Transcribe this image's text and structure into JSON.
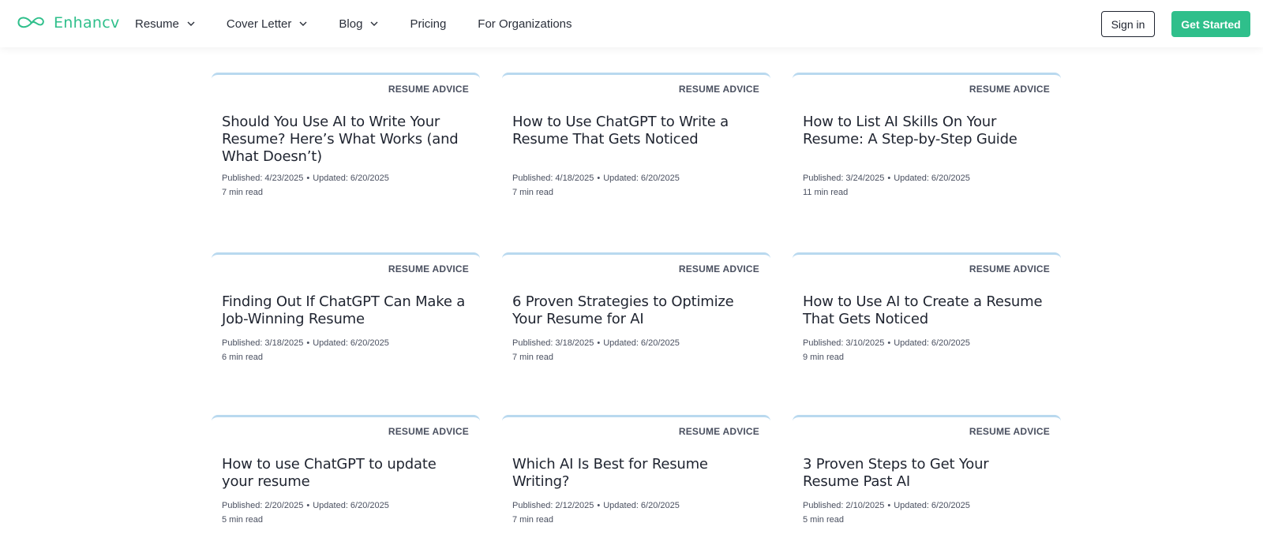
{
  "brand": {
    "name": "Enhancv",
    "accent": "#2fbf8b",
    "logo_icon": "infinity-heart-icon"
  },
  "nav": {
    "items": [
      {
        "label": "Resume",
        "has_dropdown": true
      },
      {
        "label": "Cover Letter",
        "has_dropdown": true
      },
      {
        "label": "Blog",
        "has_dropdown": true
      },
      {
        "label": "Pricing",
        "has_dropdown": false
      },
      {
        "label": "For Organizations",
        "has_dropdown": false
      }
    ],
    "sign_in": "Sign in",
    "get_started": "Get Started"
  },
  "articles": [
    {
      "category": "RESUME ADVICE",
      "title": "Should You Use AI to Write Your Resume? Here’s What Works (and What Doesn’t)",
      "published": "Published: 4/23/2025",
      "updated": "Updated: 6/20/2025",
      "read_time": "7 min read"
    },
    {
      "category": "RESUME ADVICE",
      "title": "How to Use ChatGPT to Write a Resume That Gets Noticed",
      "published": "Published: 4/18/2025",
      "updated": "Updated: 6/20/2025",
      "read_time": "7 min read"
    },
    {
      "category": "RESUME ADVICE",
      "title": "How to List AI Skills On Your Resume: A Step-by-Step Guide",
      "published": "Published: 3/24/2025",
      "updated": "Updated: 6/20/2025",
      "read_time": "11 min read"
    },
    {
      "category": "RESUME ADVICE",
      "title": "Finding Out If ChatGPT Can Make a Job-Winning Resume",
      "published": "Published: 3/18/2025",
      "updated": "Updated: 6/20/2025",
      "read_time": "6 min read"
    },
    {
      "category": "RESUME ADVICE",
      "title": "6 Proven Strategies to Optimize Your Resume for AI",
      "published": "Published: 3/18/2025",
      "updated": "Updated: 6/20/2025",
      "read_time": "7 min read"
    },
    {
      "category": "RESUME ADVICE",
      "title": "How to Use AI to Create a Resume That Gets Noticed",
      "published": "Published: 3/10/2025",
      "updated": "Updated: 6/20/2025",
      "read_time": "9 min read"
    },
    {
      "category": "RESUME ADVICE",
      "title": "How to use ChatGPT to update your resume",
      "published": "Published: 2/20/2025",
      "updated": "Updated: 6/20/2025",
      "read_time": "5 min read"
    },
    {
      "category": "RESUME ADVICE",
      "title": "Which AI Is Best for Resume Writing?",
      "published": "Published: 2/12/2025",
      "updated": "Updated: 6/20/2025",
      "read_time": "7 min read"
    },
    {
      "category": "RESUME ADVICE",
      "title": "3 Proven Steps to Get Your Resume Past AI",
      "published": "Published: 2/10/2025",
      "updated": "Updated: 6/20/2025",
      "read_time": "5 min read"
    }
  ]
}
